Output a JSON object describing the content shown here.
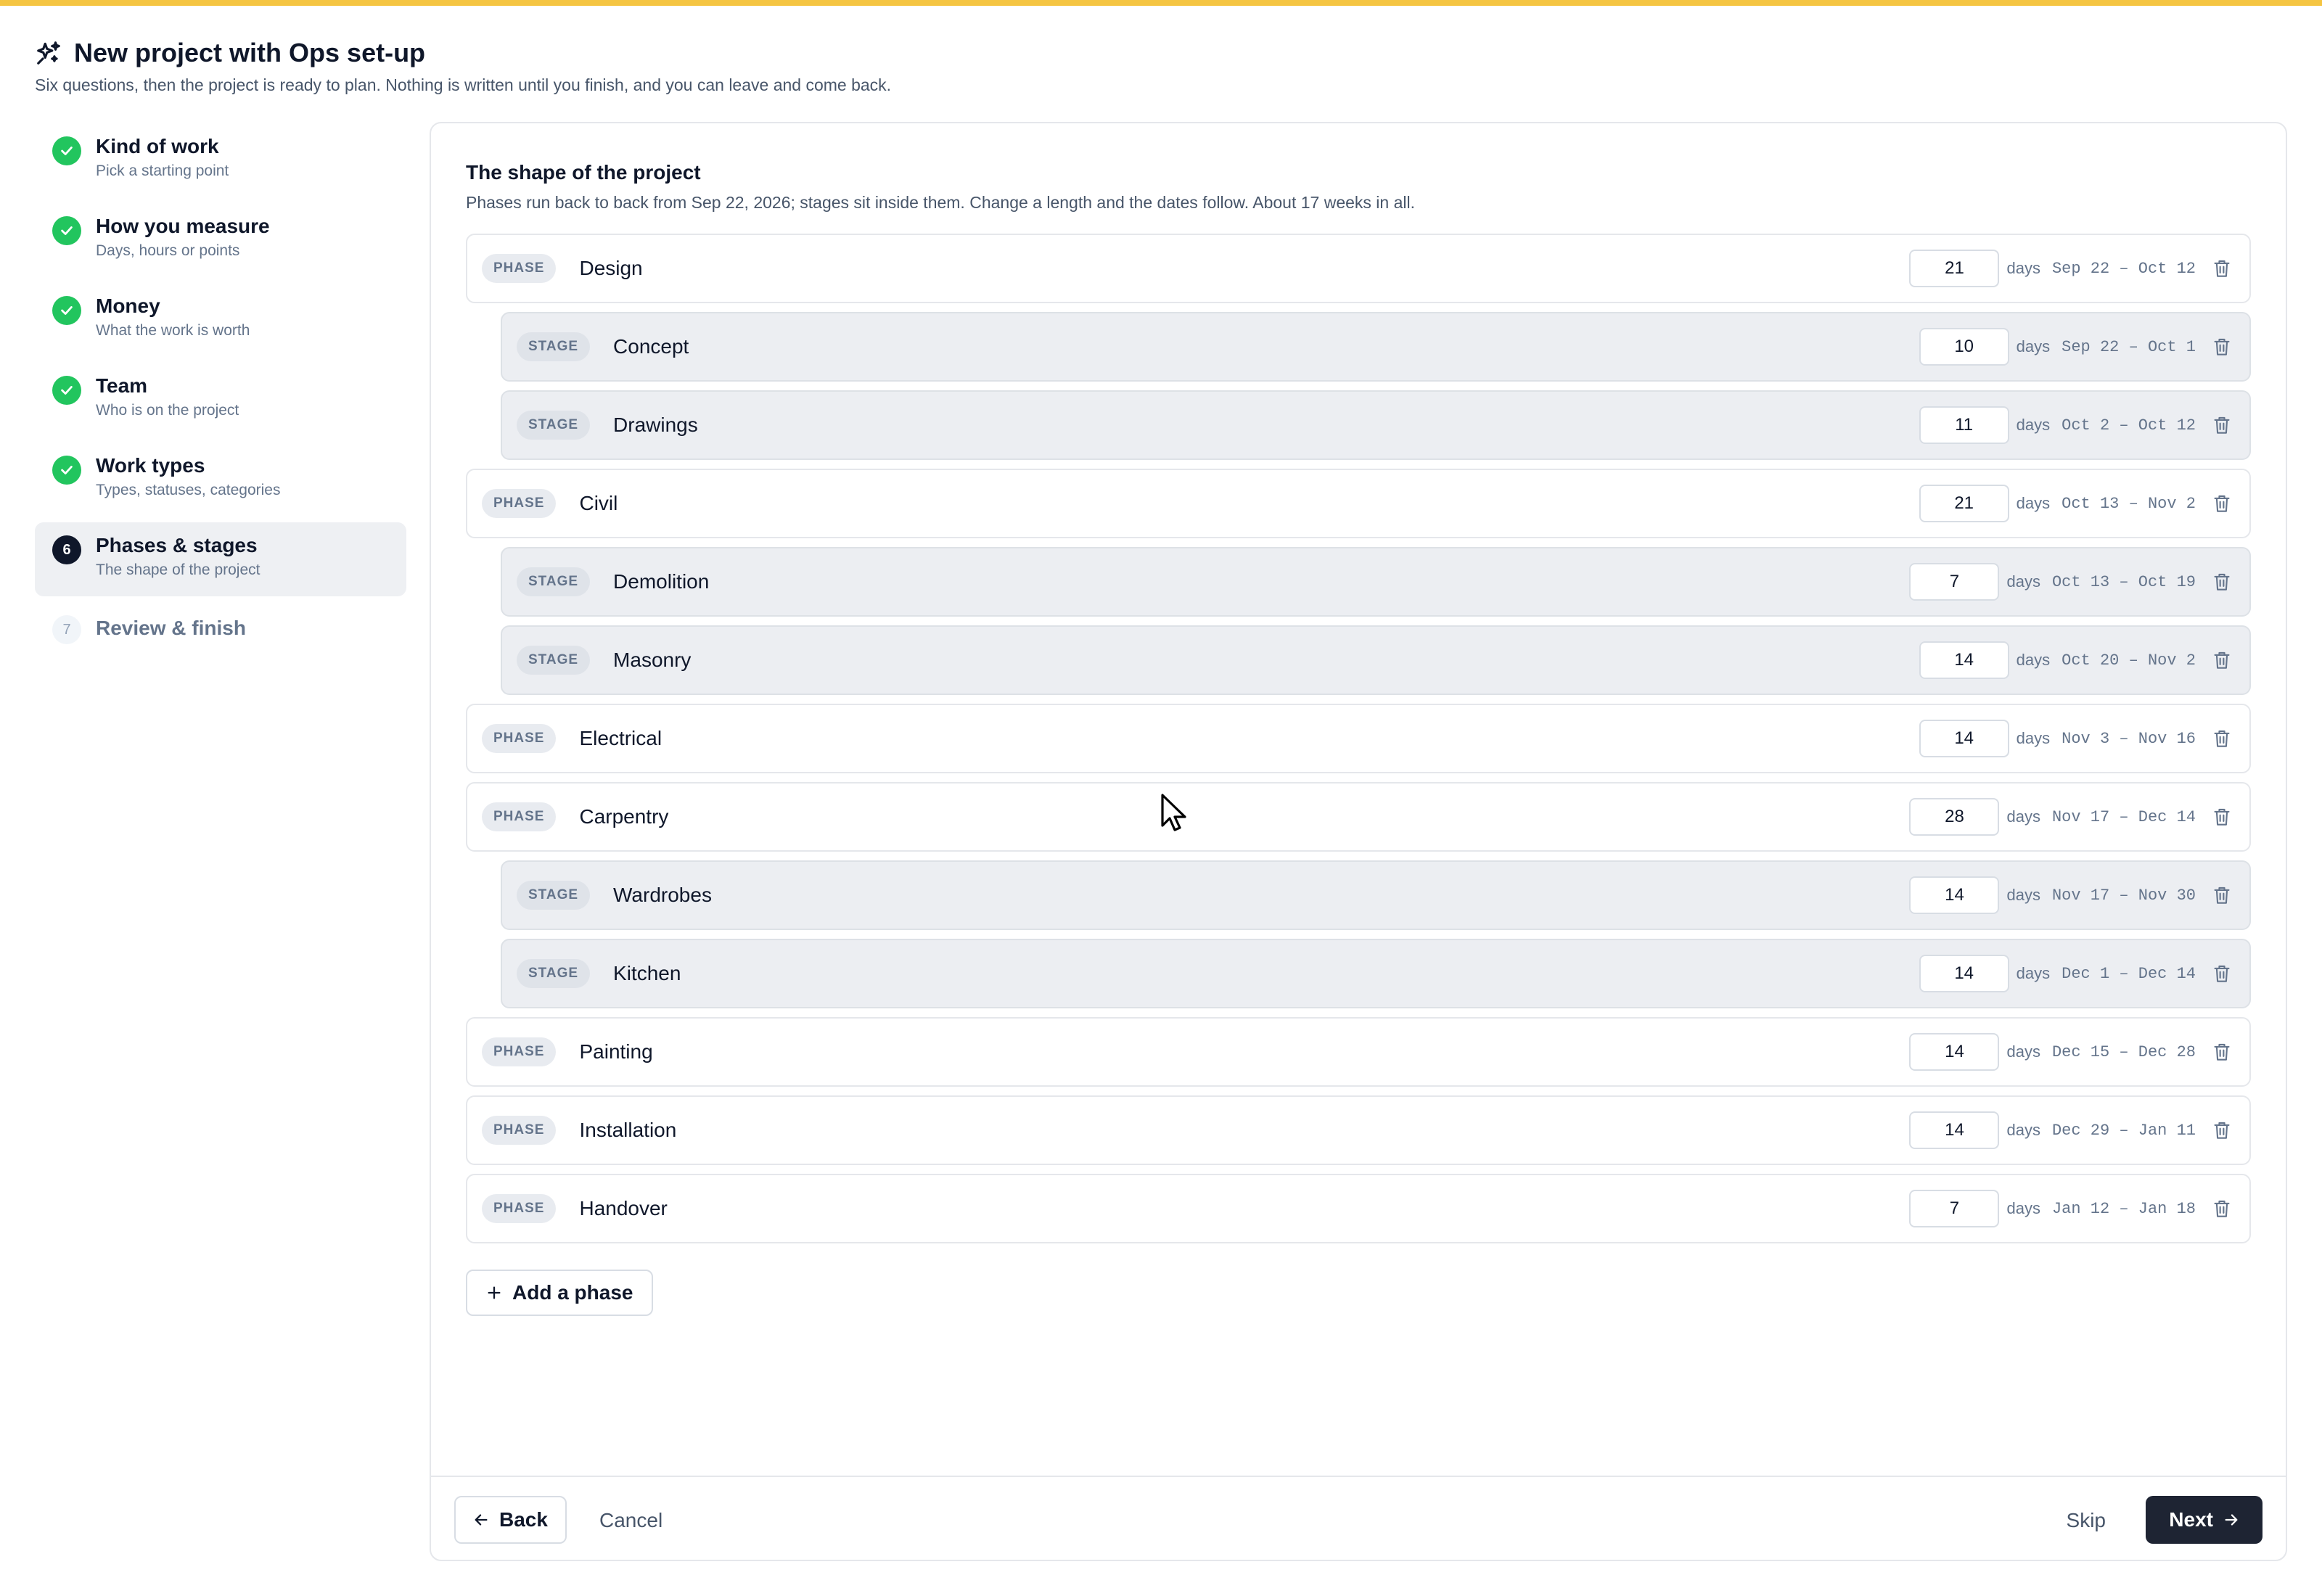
{
  "header": {
    "title": "New project with Ops set-up",
    "subtitle": "Six questions, then the project is ready to plan. Nothing is written until you finish, and you can leave and come back.",
    "icon": "sparkles-icon"
  },
  "steps": [
    {
      "title": "Kind of work",
      "sub": "Pick a starting point",
      "status": "done"
    },
    {
      "title": "How you measure",
      "sub": "Days, hours or points",
      "status": "done"
    },
    {
      "title": "Money",
      "sub": "What the work is worth",
      "status": "done"
    },
    {
      "title": "Team",
      "sub": "Who is on the project",
      "status": "done"
    },
    {
      "title": "Work types",
      "sub": "Types, statuses, categories",
      "status": "done"
    },
    {
      "title": "Phases & stages",
      "sub": "The shape of the project",
      "status": "current",
      "number": "6"
    },
    {
      "title": "Review & finish",
      "sub": "",
      "status": "todo",
      "number": "7"
    }
  ],
  "card": {
    "title": "The shape of the project",
    "description": "Phases run back to back from Sep 22, 2026; stages sit inside them. Change a length and the dates follow. About 17 weeks in all."
  },
  "days_label": "days",
  "rows": [
    {
      "kind": "PHASE",
      "name": "Design",
      "days": "21",
      "dates": "Sep 22 – Oct 12"
    },
    {
      "kind": "STAGE",
      "name": "Concept",
      "days": "10",
      "dates": "Sep 22 – Oct 1"
    },
    {
      "kind": "STAGE",
      "name": "Drawings",
      "days": "11",
      "dates": "Oct 2 – Oct 12"
    },
    {
      "kind": "PHASE",
      "name": "Civil",
      "days": "21",
      "dates": "Oct 13 – Nov 2"
    },
    {
      "kind": "STAGE",
      "name": "Demolition",
      "days": "7",
      "dates": "Oct 13 – Oct 19"
    },
    {
      "kind": "STAGE",
      "name": "Masonry",
      "days": "14",
      "dates": "Oct 20 – Nov 2"
    },
    {
      "kind": "PHASE",
      "name": "Electrical",
      "days": "14",
      "dates": "Nov 3 – Nov 16"
    },
    {
      "kind": "PHASE",
      "name": "Carpentry",
      "days": "28",
      "dates": "Nov 17 – Dec 14"
    },
    {
      "kind": "STAGE",
      "name": "Wardrobes",
      "days": "14",
      "dates": "Nov 17 – Nov 30"
    },
    {
      "kind": "STAGE",
      "name": "Kitchen",
      "days": "14",
      "dates": "Dec 1 – Dec 14"
    },
    {
      "kind": "PHASE",
      "name": "Painting",
      "days": "14",
      "dates": "Dec 15 – Dec 28"
    },
    {
      "kind": "PHASE",
      "name": "Installation",
      "days": "14",
      "dates": "Dec 29 – Jan 11"
    },
    {
      "kind": "PHASE",
      "name": "Handover",
      "days": "7",
      "dates": "Jan 12 – Jan 18"
    }
  ],
  "add_phase": "Add a phase",
  "footer": {
    "back": "Back",
    "cancel": "Cancel",
    "skip": "Skip",
    "next": "Next"
  },
  "colors": {
    "accent_bar": "#f5c542",
    "done": "#22c55e",
    "primary": "#1e2433"
  }
}
